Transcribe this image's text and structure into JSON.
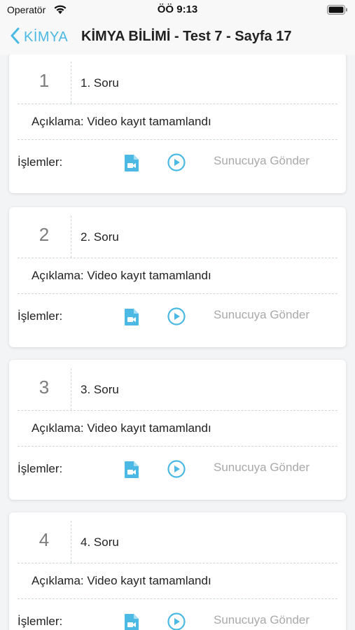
{
  "status_bar": {
    "carrier": "Operatör",
    "time": "ÖÖ 9:13"
  },
  "nav": {
    "back_label": "KİMYA",
    "title": "KİMYA BİLİMİ - Test 7 - Sayfa 17"
  },
  "accent_color": "#4bb9e3",
  "labels": {
    "operations": "İşlemler:",
    "send": "Sunucuya Gönder"
  },
  "questions": [
    {
      "number": "1",
      "title": "1. Soru",
      "description": "Açıklama: Video kayıt tamamlandı"
    },
    {
      "number": "2",
      "title": "2. Soru",
      "description": "Açıklama: Video kayıt tamamlandı"
    },
    {
      "number": "3",
      "title": "3. Soru",
      "description": "Açıklama: Video kayıt tamamlandı"
    },
    {
      "number": "4",
      "title": "4. Soru",
      "description": "Açıklama: Video kayıt tamamlandı"
    }
  ]
}
